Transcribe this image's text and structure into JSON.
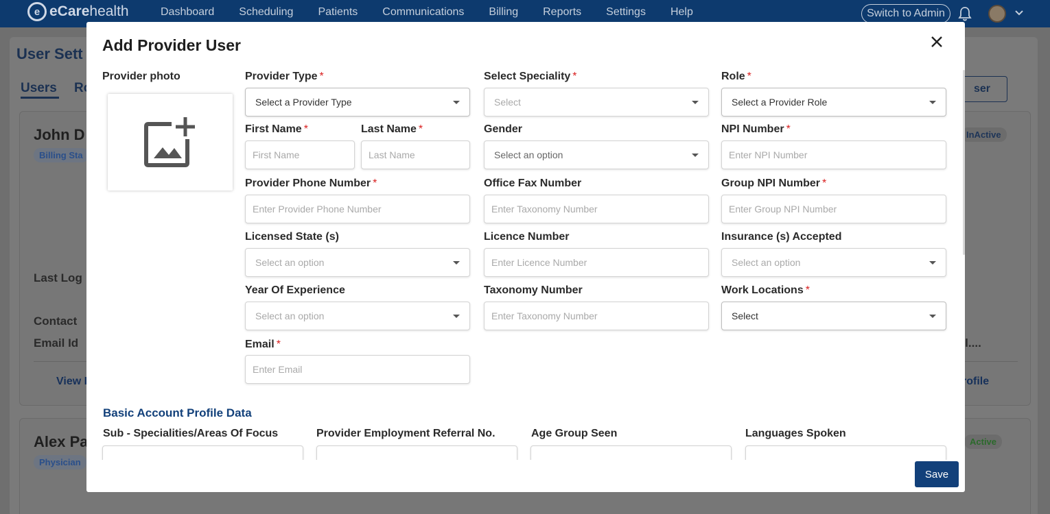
{
  "app": {
    "logo_main": "eCare",
    "logo_sub": "health",
    "nav": [
      "Dashboard",
      "Scheduling",
      "Patients",
      "Communications",
      "Billing",
      "Reports",
      "Settings",
      "Help"
    ],
    "switch_label": "Switch to Admin"
  },
  "background": {
    "page_title": "User Sett",
    "tab_users": "Users",
    "tab_roles": "Ro",
    "add_user_tail": "ser",
    "card1": {
      "name": "John D",
      "role_badge": "Billing Sta",
      "status": "InActive",
      "last_login": "Last Log",
      "contact": "Contact",
      "email": "Email Id",
      "email_tail": "ail....",
      "view_link": "View I",
      "profile_link": "rofile"
    },
    "card2": {
      "name": "Alex Pa",
      "role_badge": "Physician",
      "status": "Active"
    }
  },
  "modal": {
    "title": "Add Provider User",
    "photo_label": "Provider photo",
    "fields": {
      "provider_type": {
        "label": "Provider Type",
        "placeholder": "Select a Provider Type"
      },
      "speciality": {
        "label": "Select Speciality",
        "placeholder": "Select"
      },
      "role": {
        "label": "Role",
        "placeholder": "Select a Provider Role"
      },
      "first_name": {
        "label": "First Name",
        "placeholder": "First Name"
      },
      "last_name": {
        "label": "Last Name",
        "placeholder": "Last Name"
      },
      "gender": {
        "label": "Gender",
        "placeholder": "Select an option"
      },
      "npi": {
        "label": "NPI Number",
        "placeholder": "Enter NPI Number"
      },
      "phone": {
        "label": "Provider Phone Number",
        "placeholder": "Enter Provider Phone Number"
      },
      "fax": {
        "label": "Office Fax Number",
        "placeholder": "Enter Taxonomy Number"
      },
      "group_npi": {
        "label": "Group NPI Number",
        "placeholder": "Enter Group NPI Number"
      },
      "licensed_state": {
        "label": "Licensed State (s)",
        "placeholder": "Select an option"
      },
      "licence_number": {
        "label": "Licence Number",
        "placeholder": "Enter Licence Number"
      },
      "insurance": {
        "label": "Insurance (s) Accepted",
        "placeholder": "Select an option"
      },
      "experience": {
        "label": "Year Of Experience",
        "placeholder": "Select an option"
      },
      "taxonomy": {
        "label": "Taxonomy Number",
        "placeholder": "Enter Taxonomy Number"
      },
      "work_locations": {
        "label": "Work Locations",
        "placeholder": "Select"
      },
      "email": {
        "label": "Email",
        "placeholder": "Enter Email"
      }
    },
    "section_title": "Basic Account Profile Data",
    "section_fields": {
      "sub_specialities": "Sub - Specialities/Areas Of Focus",
      "referral": "Provider Employment Referral No.",
      "age_group": "Age Group Seen",
      "languages": "Languages Spoken"
    },
    "save_label": "Save"
  },
  "colors": {
    "nav_bg": "#0d3a6e",
    "primary": "#12407a",
    "required": "#d92020"
  },
  "icons": [
    "bell-icon",
    "chevron-down-icon",
    "close-icon",
    "add-photo-icon",
    "caret-down-icon"
  ]
}
